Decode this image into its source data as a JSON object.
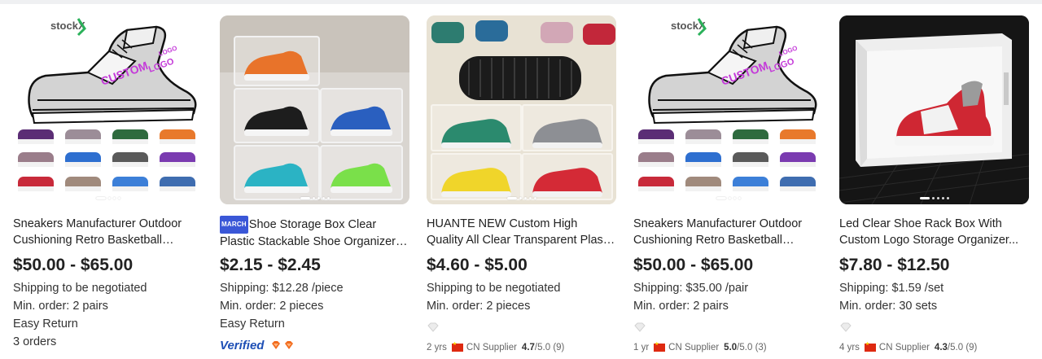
{
  "products": [
    {
      "title": "Sneakers Manufacturer Outdoor Cushioning Retro Basketball Shoes...",
      "price": "$50.00 - $65.00",
      "shipping": "Shipping to be negotiated",
      "min_order": "Min. order: 2 pairs",
      "extra1": "Easy Return",
      "extra2": "3 orders",
      "brand": "stockX",
      "image": "custom-logo-sneaker-collage"
    },
    {
      "badge": "MARCH",
      "title": "Shoe Storage Box Clear Plastic Stackable Shoe Organizer for Close...",
      "price": "$2.15 - $2.45",
      "shipping": "Shipping: $12.28 /piece",
      "min_order": "Min. order: 2 pieces",
      "extra1": "Easy Return",
      "verified": "Verified",
      "image": "clear-stacked-shoe-boxes"
    },
    {
      "title": "HUANTE NEW Custom High Quality All Clear Transparent Plastic Shoe...",
      "price": "$4.60 - $5.00",
      "shipping": "Shipping to be negotiated",
      "min_order": "Min. order: 2 pieces",
      "supplier": {
        "years": "2 yrs",
        "country": "CN Supplier",
        "rating": "4.7",
        "scale": "/5.0",
        "reviews": "(9)"
      },
      "image": "shoe-boxes-with-tire"
    },
    {
      "title": "Sneakers Manufacturer Outdoor Cushioning Retro Basketball Shoes...",
      "price": "$50.00 - $65.00",
      "shipping": "Shipping: $35.00 /pair",
      "min_order": "Min. order: 2 pairs",
      "supplier": {
        "years": "1 yr",
        "country": "CN Supplier",
        "rating": "5.0",
        "scale": "/5.0",
        "reviews": "(3)"
      },
      "brand": "stockX",
      "image": "custom-logo-sneaker-collage"
    },
    {
      "title": "Led Clear Shoe Rack Box With Custom Logo Storage Organizer...",
      "price": "$7.80 - $12.50",
      "shipping": "Shipping: $1.59 /set",
      "min_order": "Min. order: 30 sets",
      "supplier": {
        "years": "4 yrs",
        "country": "CN Supplier",
        "rating": "4.3",
        "scale": "/5.0",
        "reviews": "(9)"
      },
      "image": "led-shoe-box-dark"
    }
  ],
  "logo_text": {
    "custom": "CUSTOM",
    "logo": "LOGO"
  },
  "colors": {
    "accent_blue": "#1e4fb5",
    "badge_orange": "#f26b1d",
    "text": "#222222"
  }
}
